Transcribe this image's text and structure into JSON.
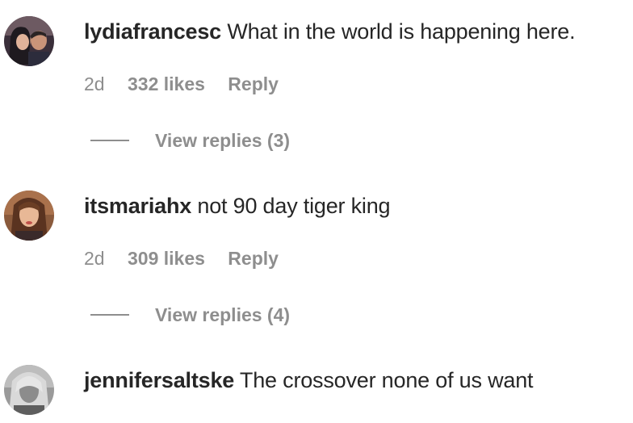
{
  "comments": [
    {
      "username": "lydiafrancesc",
      "text": "What in the world is happening here.",
      "time": "2d",
      "likes": "332 likes",
      "reply_label": "Reply",
      "view_replies": "View replies (3)"
    },
    {
      "username": "itsmariahx",
      "text": "not 90 day tiger king",
      "time": "2d",
      "likes": "309 likes",
      "reply_label": "Reply",
      "view_replies": "View replies (4)"
    },
    {
      "username": "jennifersaltske",
      "text": "The crossover none of us want"
    }
  ],
  "colors": {
    "text": "#262626",
    "secondary": "#8e8e8e",
    "background": "#ffffff"
  }
}
